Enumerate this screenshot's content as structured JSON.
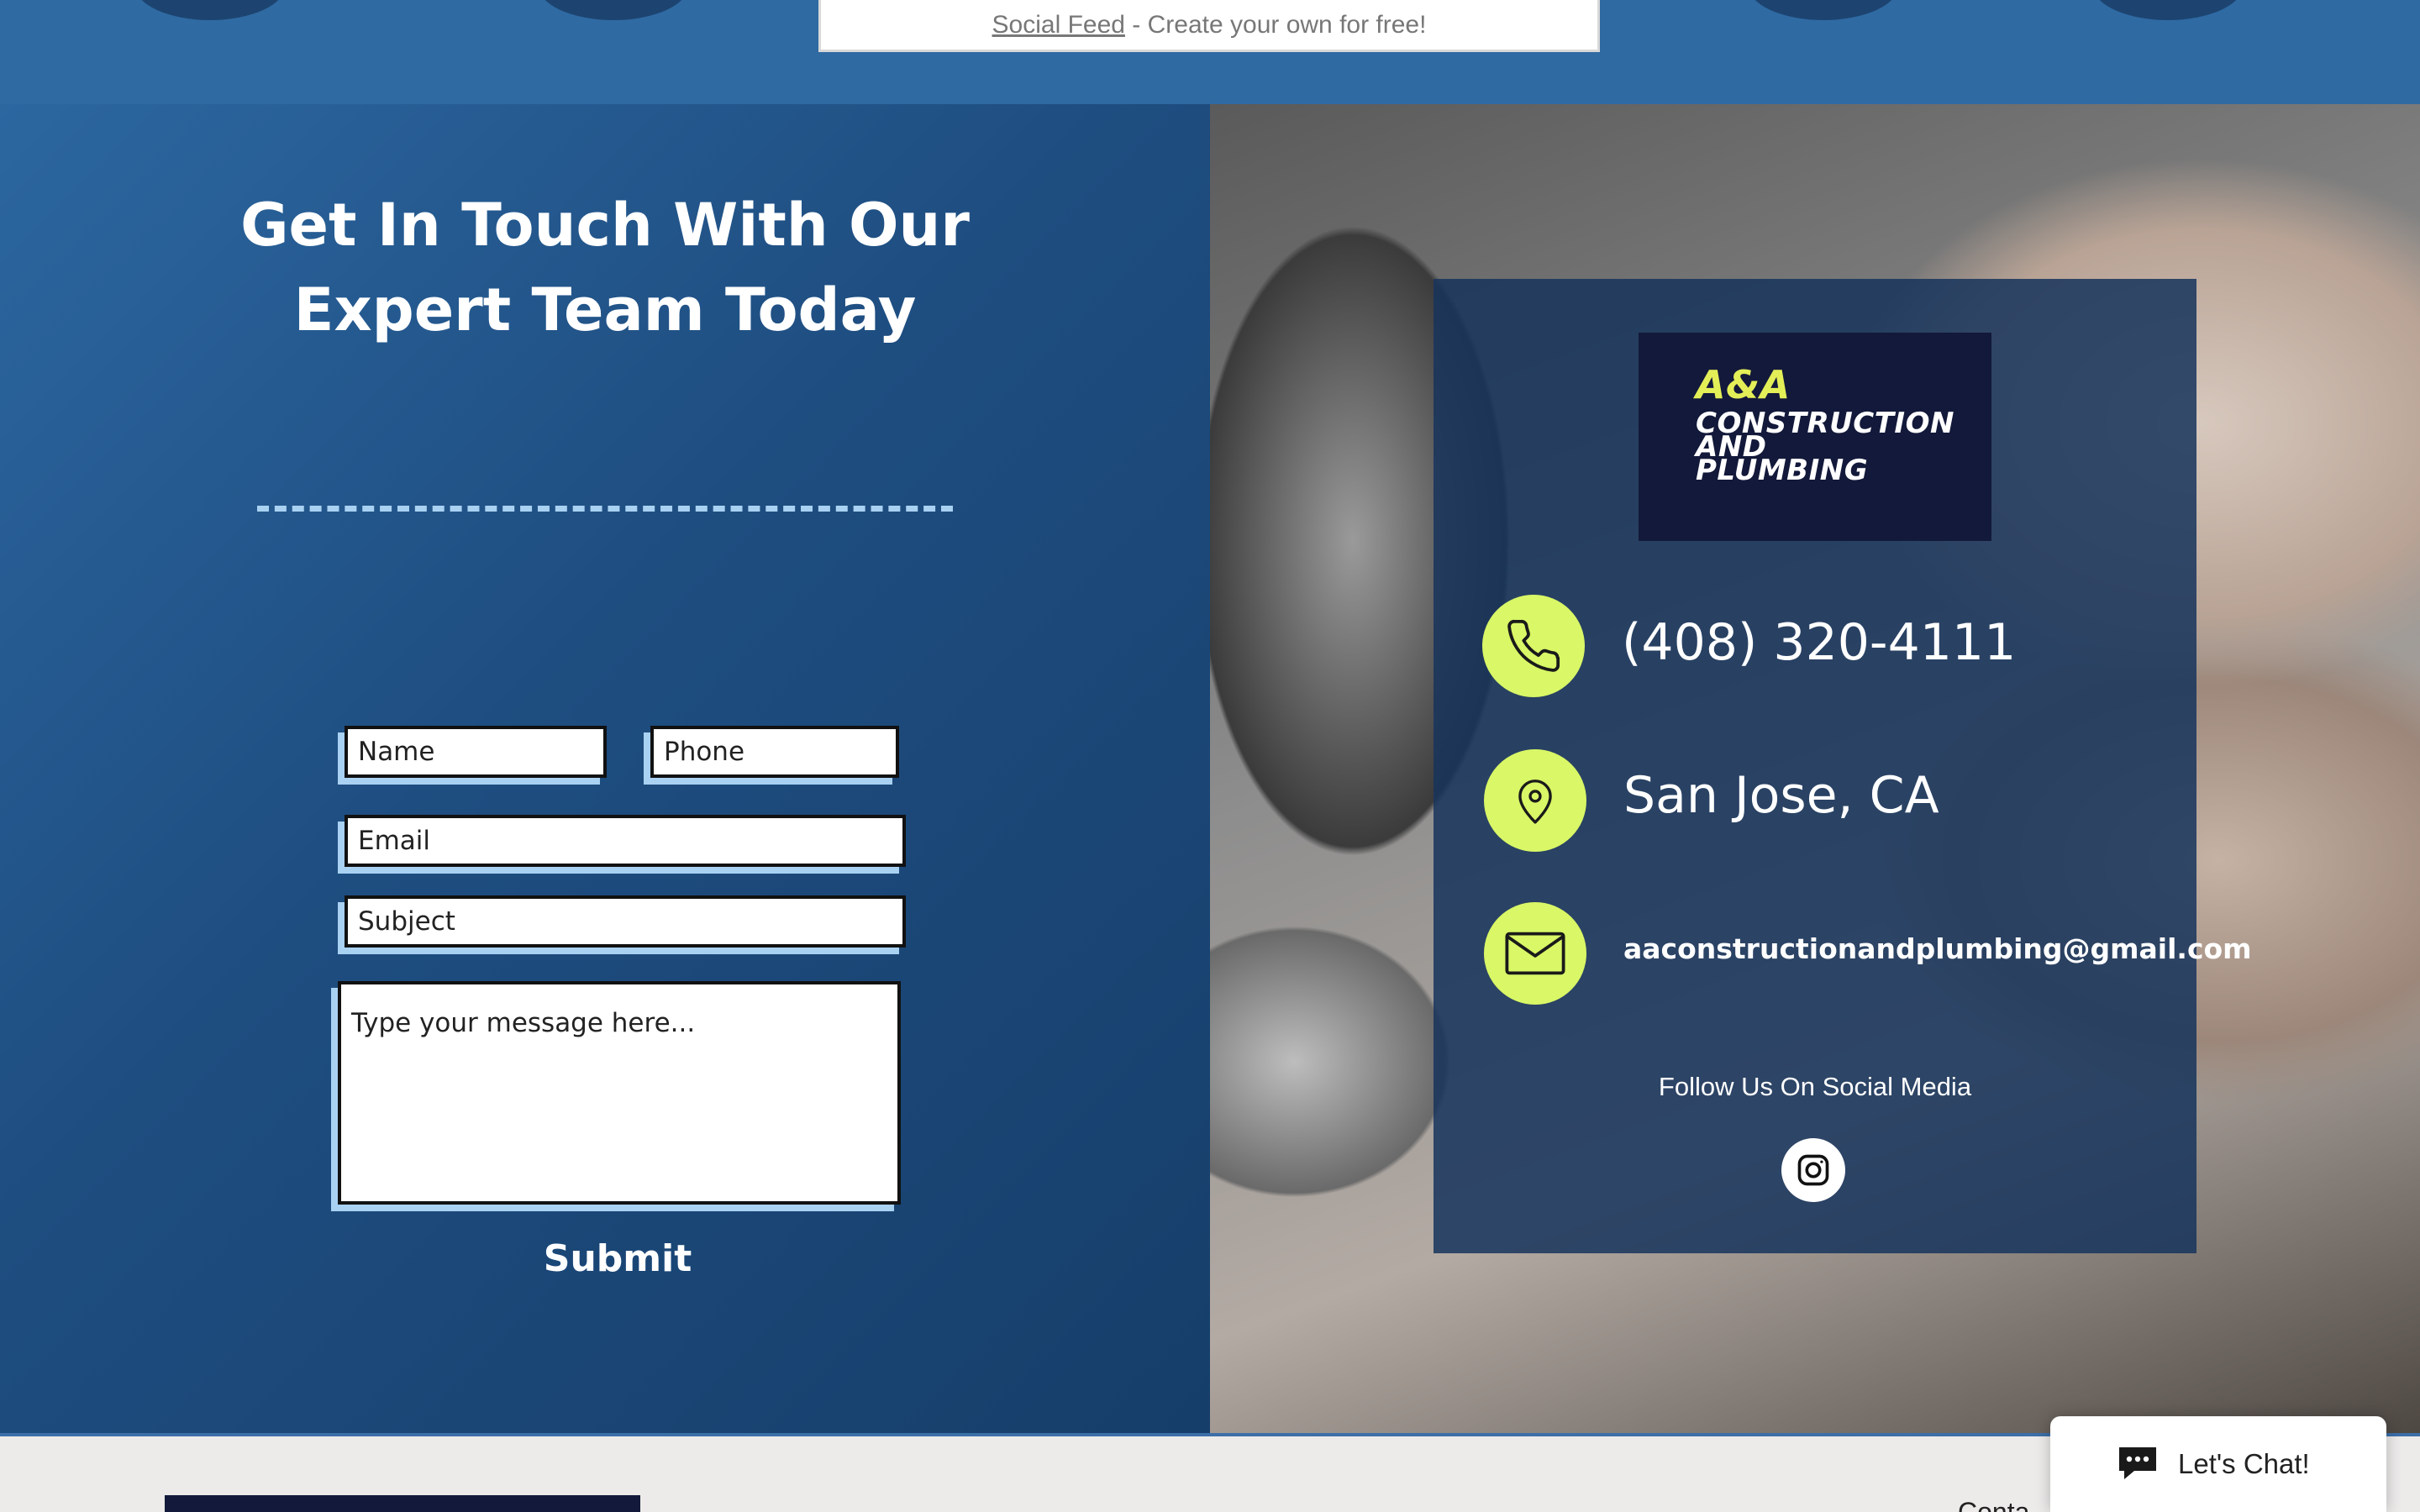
{
  "top_bar": {
    "feed_link": "Social Feed",
    "feed_suffix": " - Create your own for free!"
  },
  "contact_form": {
    "headline": "Get In Touch With Our Expert Team Today",
    "name_placeholder": "Name",
    "phone_placeholder": "Phone",
    "email_placeholder": "Email",
    "subject_placeholder": "Subject",
    "message_placeholder": "Type your message here...",
    "submit_label": "Submit"
  },
  "info_card": {
    "logo_line1": "A&A",
    "logo_line2": "CONSTRUCTION",
    "logo_line3": "AND",
    "logo_line4": "PLUMBING",
    "phone": "(408) 320-4111",
    "location": "San Jose, CA",
    "email": "aaconstructionandplumbing@gmail.com",
    "follow_label": "Follow Us On Social Media",
    "icons": [
      "phone-icon",
      "map-pin-icon",
      "envelope-icon",
      "instagram-icon"
    ]
  },
  "footer": {
    "partial_text": "Conta"
  },
  "chat_widget": {
    "label": "Let's Chat!"
  },
  "colors": {
    "accent": "#d9f766",
    "panel_blue": "#1e4d80",
    "logo_navy": "#13193a",
    "dash_light_blue": "#a9d1f2"
  }
}
